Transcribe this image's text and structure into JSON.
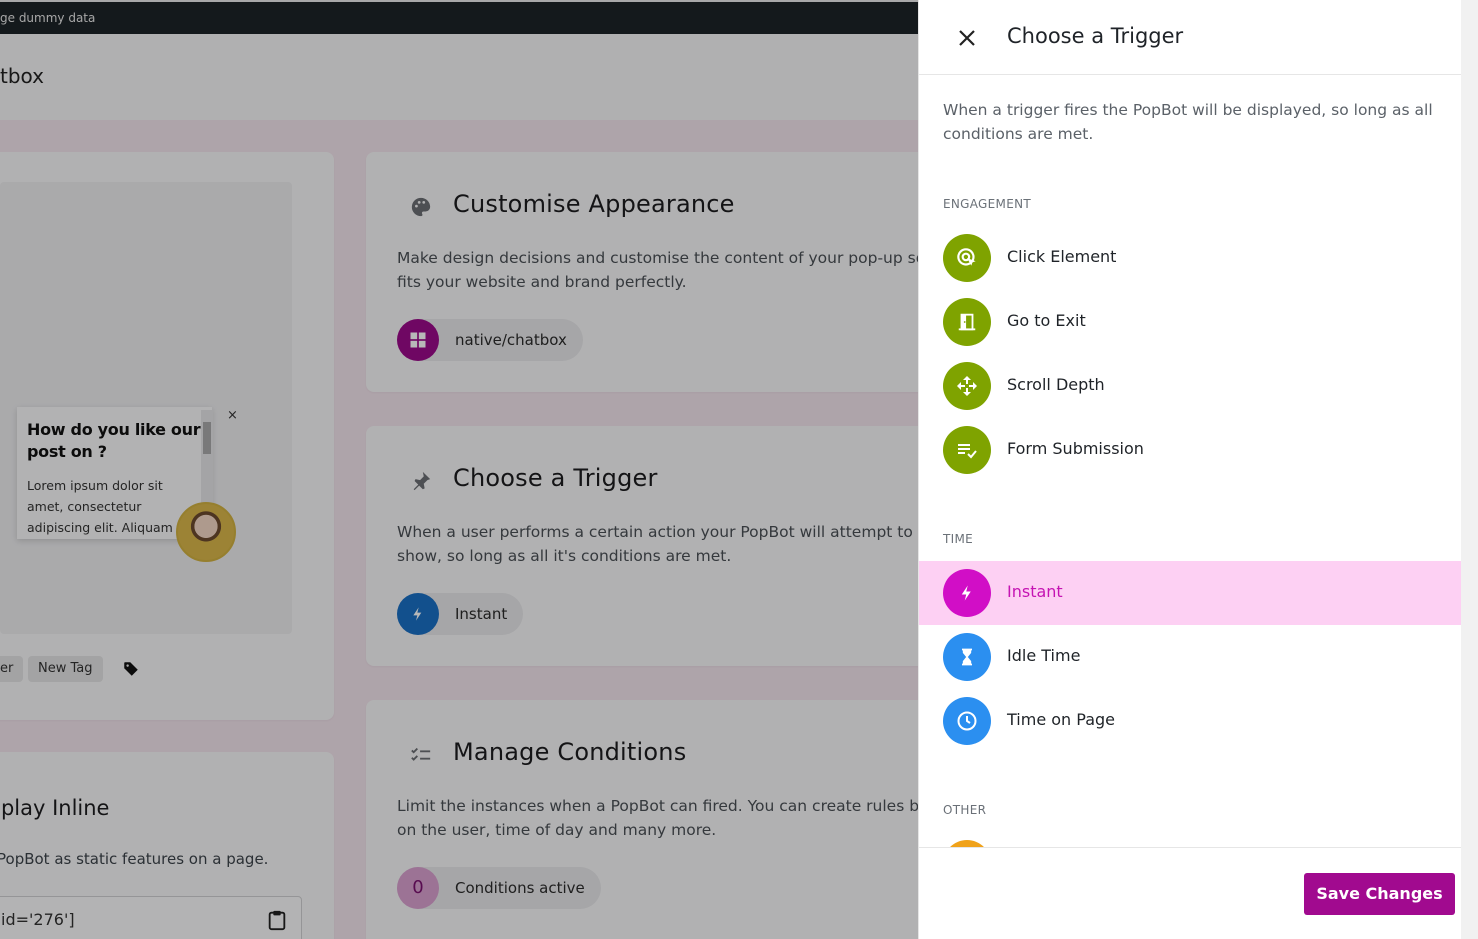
{
  "topbar": {
    "text": "ge dummy data"
  },
  "page": {
    "title": "tbox"
  },
  "preview": {
    "popup_title": "How do you like our post on ?",
    "popup_text": "Lorem ipsum dolor sit amet, consectetur adipiscing elit. Aliquam s",
    "close_glyph": "×"
  },
  "tags": [
    "er",
    "New Tag"
  ],
  "inline": {
    "title": "splay Inline",
    "desc": "PopBot as static features on a page.",
    "shortcode": "id='276']"
  },
  "features": {
    "appearance": {
      "title": "Customise Appearance",
      "desc": "Make design decisions and customise the content of your pop-up so it fits your website and brand perfectly.",
      "chip": "native/chatbox"
    },
    "trigger": {
      "title": "Choose a Trigger",
      "desc": "When a user performs a certain action your PopBot will attempt to show, so long as all it's conditions are met.",
      "chip": "Instant"
    },
    "conditions": {
      "title": "Manage Conditions",
      "desc": "Limit the instances when a PopBot can fired. You can create rules based on the user, time of day and many more.",
      "chip": "Conditions active",
      "count": "0"
    }
  },
  "drawer": {
    "title": "Choose a Trigger",
    "description": "When a trigger fires the PopBot will be displayed, so long as all conditions are met.",
    "sections": {
      "engagement": "ENGAGEMENT",
      "time": "TIME",
      "other": "OTHER"
    },
    "engagement": [
      "Click Element",
      "Go to Exit",
      "Scroll Depth",
      "Form Submission"
    ],
    "time": [
      "Instant",
      "Idle Time",
      "Time on Page"
    ],
    "selected": "Instant",
    "save_label": "Save Changes",
    "colors": {
      "engagement": "#7fa300",
      "time": "#2b8ff0",
      "selected": "#d10ec6",
      "selected_bg": "#fdd0f3",
      "save": "#a10a8f"
    }
  }
}
